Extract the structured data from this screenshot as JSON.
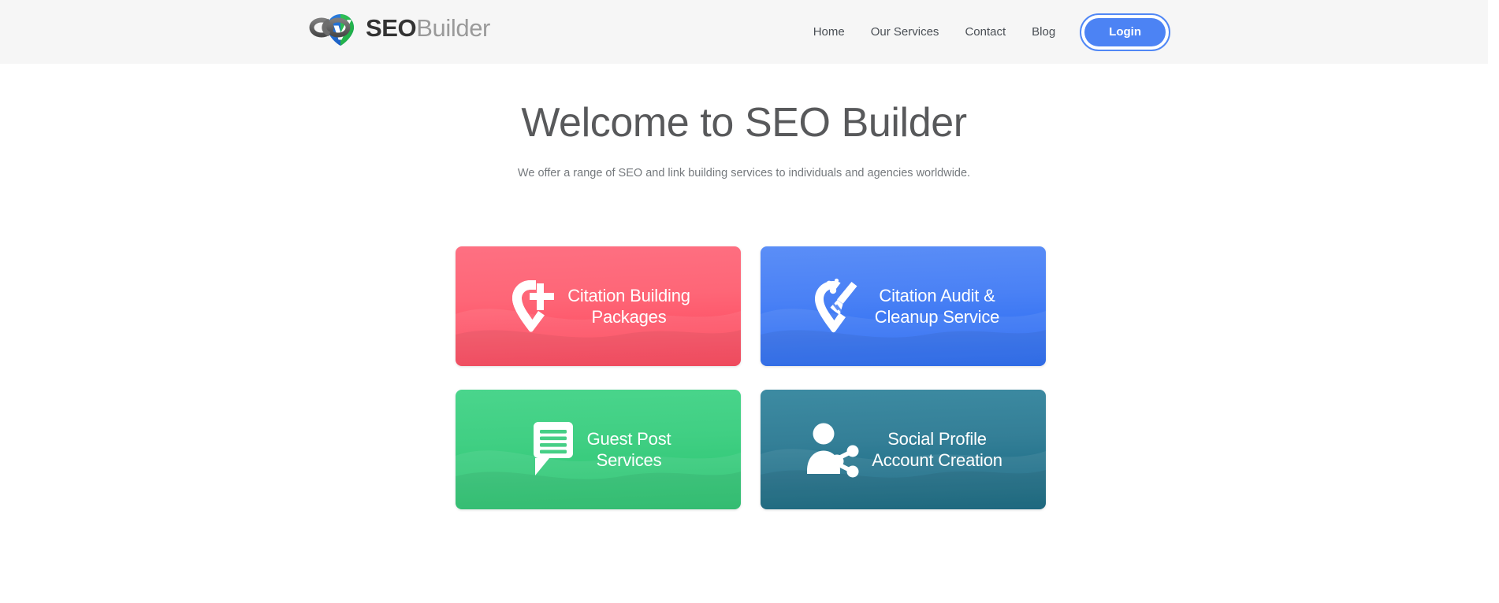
{
  "header": {
    "logo": {
      "icon": "seo-builder-logo-icon",
      "text_primary": "SEO",
      "text_secondary": "Builder"
    },
    "nav": [
      {
        "label": "Home",
        "name": "nav-link-home"
      },
      {
        "label": "Our Services",
        "name": "nav-link-our-services"
      },
      {
        "label": "Contact",
        "name": "nav-link-contact"
      },
      {
        "label": "Blog",
        "name": "nav-link-blog"
      }
    ],
    "login_label": "Login",
    "background_color": "#f6f6f6"
  },
  "hero": {
    "title": "Welcome to SEO Builder",
    "subtitle": "We offer a range of SEO and link building services to individuals and agencies worldwide."
  },
  "cards": [
    {
      "label_line1": "Citation Building",
      "label_line2": "Packages",
      "icon": "map-pin-plus-icon",
      "color": "#fc4258",
      "name": "card-citation-building-packages"
    },
    {
      "label_line1": "Citation Audit &",
      "label_line2": "Cleanup Service",
      "icon": "map-pin-broom-icon",
      "color": "#2367f2",
      "name": "card-citation-audit-cleanup-service"
    },
    {
      "label_line1": "Guest Post",
      "label_line2": "Services",
      "icon": "speech-bubble-lines-icon",
      "color": "#27c36e",
      "name": "card-guest-post-services"
    },
    {
      "label_line1": "Social Profile",
      "label_line2": "Account Creation",
      "icon": "person-share-icon",
      "color": "#10657f",
      "name": "card-social-profile-account-creation"
    }
  ],
  "colors": {
    "accent_blue": "#4c83f4",
    "title_gray": "#58595b",
    "subtitle_gray": "#75797d",
    "page_background": "#ffffff"
  }
}
